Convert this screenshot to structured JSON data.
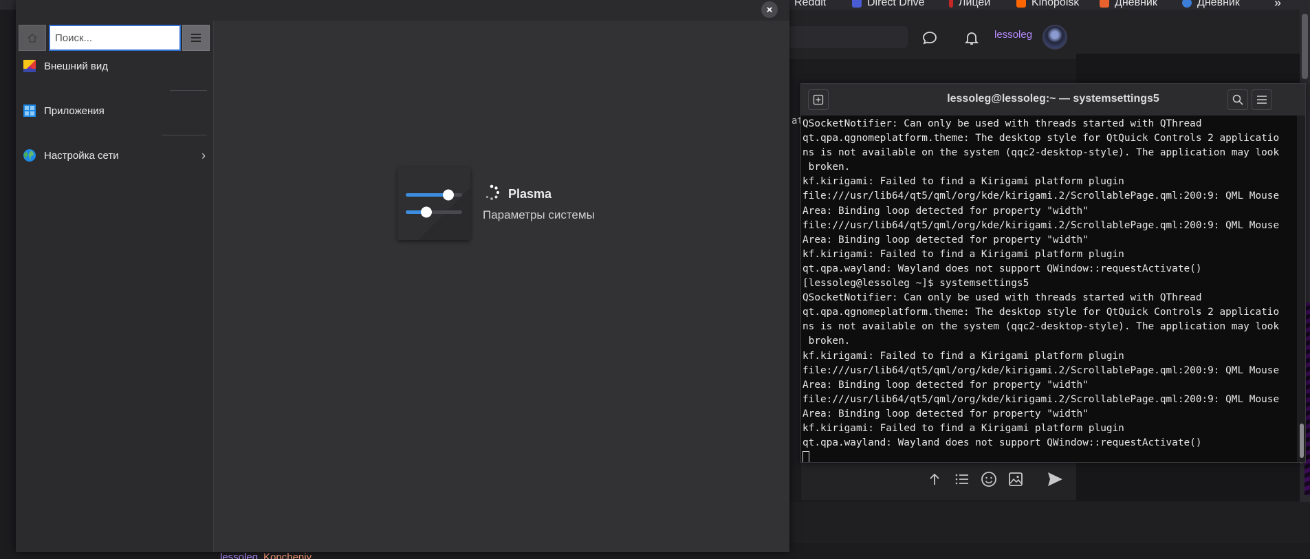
{
  "bookmarks": [
    {
      "label": "Reddit",
      "color": "#ff4500"
    },
    {
      "label": "Direct Drive",
      "color": "#4a5bd6"
    },
    {
      "label": "Лицей",
      "color": "#c62828"
    },
    {
      "label": "Kinopoisk",
      "color": "#ff6600"
    },
    {
      "label": "Дневник",
      "color": "#e8622d"
    },
    {
      "label": "Дневник",
      "color": "#3b7dd8"
    }
  ],
  "bookmarks_more": "»",
  "site": {
    "username": "lessoleg",
    "chat_icon": "chat-bubble-icon",
    "bell_icon": "bell-icon"
  },
  "bottom": {
    "username": "lessoleg",
    "text": "Kopcheniy"
  },
  "stray_text": "at",
  "settings": {
    "close_label": "×",
    "search_placeholder": "Поиск...",
    "nav": [
      {
        "label": "Внешний вид",
        "icon": "appearance-icon"
      },
      {
        "label": "Приложения",
        "icon": "applications-icon"
      },
      {
        "label": "Настройка сети",
        "icon": "network-globe-icon"
      }
    ],
    "splash": {
      "title": "Plasma",
      "subtitle": "Параметры системы"
    }
  },
  "terminal": {
    "title": "lessoleg@lessoleg:~ — systemsettings5",
    "lines": [
      "QSocketNotifier: Can only be used with threads started with QThread",
      "qt.qpa.qgnomeplatform.theme: The desktop style for QtQuick Controls 2 applicatio",
      "ns is not available on the system (qqc2-desktop-style). The application may look",
      " broken.",
      "kf.kirigami: Failed to find a Kirigami platform plugin",
      "file:///usr/lib64/qt5/qml/org/kde/kirigami.2/ScrollablePage.qml:200:9: QML Mouse",
      "Area: Binding loop detected for property \"width\"",
      "file:///usr/lib64/qt5/qml/org/kde/kirigami.2/ScrollablePage.qml:200:9: QML Mouse",
      "Area: Binding loop detected for property \"width\"",
      "kf.kirigami: Failed to find a Kirigami platform plugin",
      "qt.qpa.wayland: Wayland does not support QWindow::requestActivate()",
      "[lessoleg@lessoleg ~]$ systemsettings5",
      "QSocketNotifier: Can only be used with threads started with QThread",
      "qt.qpa.qgnomeplatform.theme: The desktop style for QtQuick Controls 2 applicatio",
      "ns is not available on the system (qqc2-desktop-style). The application may look",
      " broken.",
      "kf.kirigami: Failed to find a Kirigami platform plugin",
      "file:///usr/lib64/qt5/qml/org/kde/kirigami.2/ScrollablePage.qml:200:9: QML Mouse",
      "Area: Binding loop detected for property \"width\"",
      "file:///usr/lib64/qt5/qml/org/kde/kirigami.2/ScrollablePage.qml:200:9: QML Mouse",
      "Area: Binding loop detected for property \"width\"",
      "kf.kirigami: Failed to find a Kirigami platform plugin",
      "qt.qpa.wayland: Wayland does not support QWindow::requestActivate()"
    ]
  }
}
